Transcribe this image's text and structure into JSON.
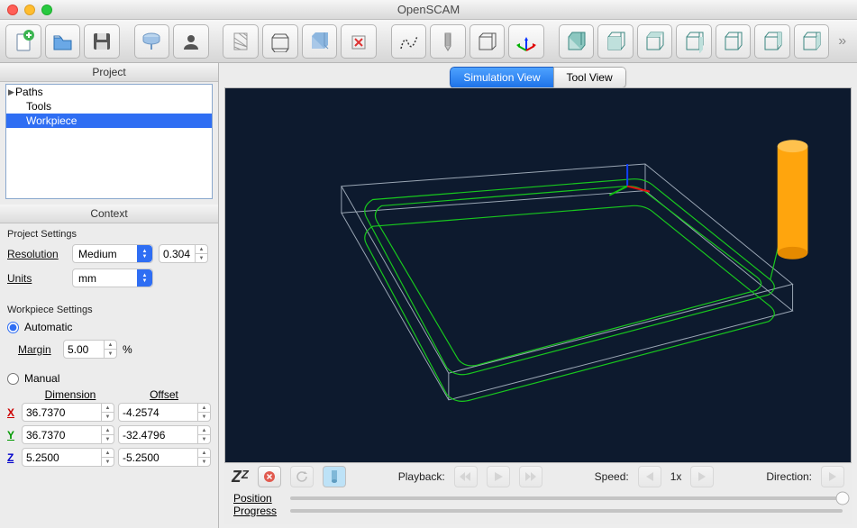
{
  "window": {
    "title": "OpenSCAM"
  },
  "sidebar": {
    "project_header": "Project",
    "context_header": "Context",
    "tree": {
      "paths": "Paths",
      "tools": "Tools",
      "workpiece": "Workpiece"
    },
    "project_settings": {
      "title": "Project Settings",
      "resolution_label": "Resolution",
      "resolution_value": "Medium",
      "resolution_num": "0.304",
      "units_label": "Units",
      "units_value": "mm"
    },
    "workpiece_settings": {
      "title": "Workpiece Settings",
      "automatic_label": "Automatic",
      "margin_label": "Margin",
      "margin_value": "5.00",
      "margin_unit": "%",
      "manual_label": "Manual",
      "dimension_header": "Dimension",
      "offset_header": "Offset",
      "x": {
        "dim": "36.7370",
        "off": "-4.2574"
      },
      "y": {
        "dim": "36.7370",
        "off": "-32.4796"
      },
      "z": {
        "dim": "5.2500",
        "off": "-5.2500"
      }
    }
  },
  "tabs": {
    "simulation": "Simulation View",
    "tool": "Tool View"
  },
  "playback": {
    "label": "Playback:",
    "speed_label": "Speed:",
    "speed_value": "1x",
    "direction_label": "Direction:",
    "position_label": "Position",
    "progress_label": "Progress"
  }
}
